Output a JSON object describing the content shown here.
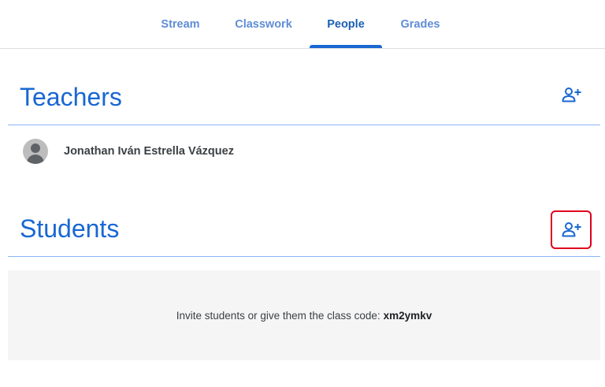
{
  "nav": {
    "tabs": [
      {
        "label": "Stream"
      },
      {
        "label": "Classwork"
      },
      {
        "label": "People",
        "active": true
      },
      {
        "label": "Grades"
      }
    ]
  },
  "teachers": {
    "title": "Teachers",
    "add_icon": "person-add-icon",
    "list": [
      {
        "name": "Jonathan Iván Estrella Vázquez"
      }
    ]
  },
  "students": {
    "title": "Students",
    "add_icon": "person-add-icon",
    "invite_text": "Invite students or give them the class code:",
    "class_code": "xm2ymkv"
  },
  "colors": {
    "accent": "#1967d2",
    "highlight": "#e0001b"
  }
}
